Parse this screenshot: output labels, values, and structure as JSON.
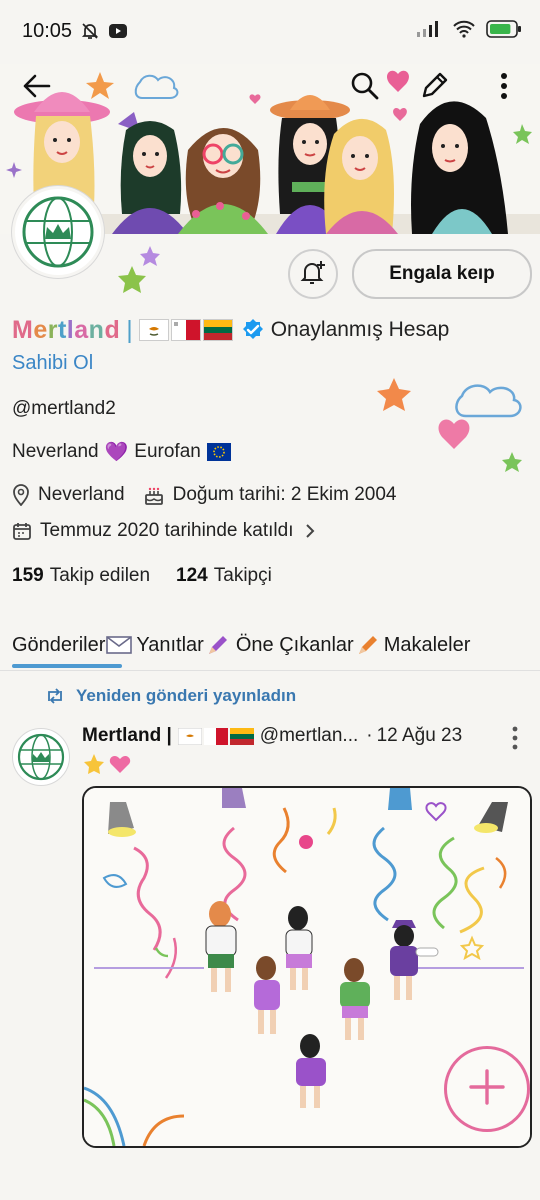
{
  "status_bar": {
    "time": "10:05",
    "left_icons": [
      "bell-off-icon",
      "youtube-icon"
    ],
    "right_icons": [
      "signal-icon",
      "wifi-icon",
      "battery-icon"
    ],
    "battery_level": 0.85
  },
  "header": {
    "back_icon": "arrow-left-icon",
    "search_icon": "search-icon",
    "compose_icon": "pencil-icon",
    "more_icon": "more-vertical-icon"
  },
  "profile": {
    "name": "Mertland",
    "name_separator": "|",
    "flags": [
      "cyprus-flag",
      "malta-flag",
      "lithuania-flag"
    ],
    "verified_label": "Onaylanmış Hesap",
    "claim_label": "Sahibi Ol",
    "handle": "@mertland2",
    "bio_text_1": "Neverland",
    "bio_emoji_1": "💜",
    "bio_text_2": "Eurofan",
    "bio_emoji_2": "🇪🇺",
    "location": "Neverland",
    "birthday": "Doğum tarihi: 2 Ekim 2004",
    "joined": "Temmuz 2020 tarihinde katıldı",
    "following_count": "159",
    "following_label": "Takip edilen",
    "followers_count": "124",
    "followers_label": "Takipçi",
    "follow_button": "Engala keıp",
    "notify_icon": "bell-plus-icon"
  },
  "tabs": [
    {
      "label": "Gönderiler",
      "emoji": "✉️"
    },
    {
      "label": "Yanıtlar",
      "emoji": "🖍️"
    },
    {
      "label": "Öne Çıkanlar",
      "emoji": "🖍️"
    },
    {
      "label": "Makaleler",
      "emoji": ""
    }
  ],
  "post": {
    "repost_label": "Yeniden gönderi yayınladın",
    "author_name": "Mertland |",
    "author_handle": "@mertlan...",
    "date_sep": "·",
    "date": "12 Ağu 23",
    "text_emojis": "⭐💗"
  },
  "colors": {
    "accent": "#4e9ad1",
    "link": "#3b86c6",
    "verified": "#1d9bf0",
    "fab": "#e46a9c"
  }
}
